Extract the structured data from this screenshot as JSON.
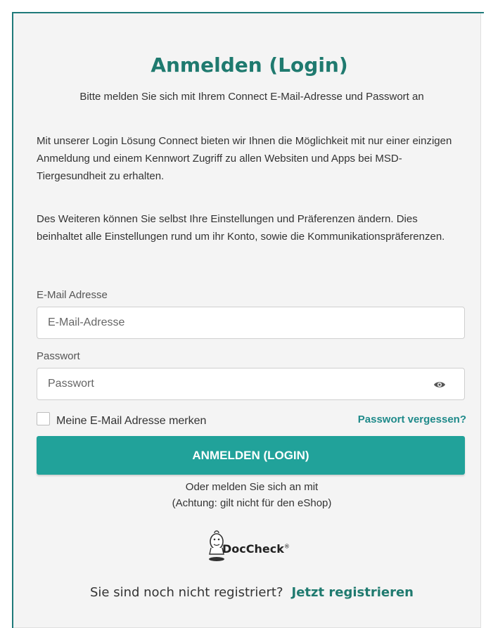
{
  "heading": {
    "title": "Anmelden (Login)",
    "subtitle": "Bitte melden Sie sich mit Ihrem Connect E-Mail-Adresse und Passwort an"
  },
  "intro": {
    "paragraph1": "Mit unserer Login Lösung Connect bieten wir Ihnen die Möglichkeit mit nur einer einzigen Anmeldung und einem Kennwort Zugriff zu allen Websiten und Apps bei MSD-Tiergesundheit zu erhalten.",
    "paragraph2": "Des Weiteren können Sie selbst Ihre Einstellungen und Präferenzen ändern. Dies beinhaltet alle Einstellungen rund um ihr Konto, sowie die Kommunikationspräferenzen."
  },
  "form": {
    "email_label": "E-Mail Adresse",
    "email_placeholder": "E-Mail-Adresse",
    "email_value": "",
    "password_label": "Passwort",
    "password_placeholder": "Passwort",
    "password_value": "",
    "password_toggle_icon": "eye-icon",
    "remember_label": "Meine E-Mail Adresse merken",
    "remember_checked": false,
    "forgot_link": "Passwort vergessen?",
    "submit_label": "ANMELDEN (LOGIN)"
  },
  "alternative": {
    "line1": "Oder melden Sie sich an mit",
    "line2": "(Achtung: gilt nicht für den eShop)",
    "provider_name": "DocCheck",
    "provider_mark": "®",
    "provider_icon": "doccheck-logo-icon"
  },
  "register": {
    "prompt": "Sie sind noch nicht registriert?",
    "link": "Jetzt registrieren"
  },
  "colors": {
    "accent": "#21a29a",
    "heading": "#1f7a6f",
    "link": "#1f8a8a",
    "frame": "#1f7a7a"
  }
}
